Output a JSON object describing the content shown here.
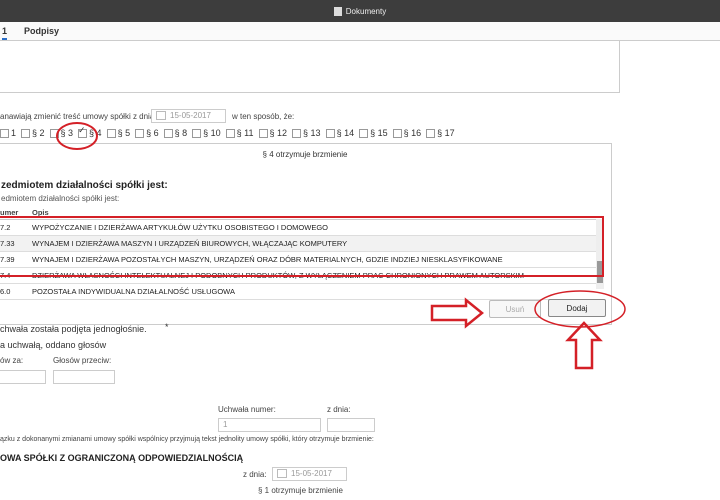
{
  "window": {
    "title": "Dokumenty"
  },
  "tabs": [
    {
      "label": "1"
    },
    {
      "label": "Podpisy"
    }
  ],
  "intro": {
    "prefix": "anawiają zmienić treść umowy spółki z dnia",
    "date": "15-05-2017",
    "suffix": "w ten sposób, że:"
  },
  "paragraphs": [
    {
      "label": "1",
      "checked": false
    },
    {
      "label": "§ 2",
      "checked": false
    },
    {
      "label": "§ 3",
      "checked": false
    },
    {
      "label": "§ 4",
      "checked": true
    },
    {
      "label": "§ 5",
      "checked": false
    },
    {
      "label": "§ 6",
      "checked": false
    },
    {
      "label": "§ 8",
      "checked": false
    },
    {
      "label": "§ 10",
      "checked": false
    },
    {
      "label": "§ 11",
      "checked": false
    },
    {
      "label": "§ 12",
      "checked": false
    },
    {
      "label": "§ 13",
      "checked": false
    },
    {
      "label": "§ 14",
      "checked": false
    },
    {
      "label": "§ 15",
      "checked": false
    },
    {
      "label": "§ 16",
      "checked": false
    },
    {
      "label": "§ 17",
      "checked": false
    }
  ],
  "panel": {
    "title": "§ 4 otrzymuje brzmienie",
    "heading": "zedmiotem działalności spółki jest:",
    "subheading": "edmiotem działalności spółki jest:",
    "columns": [
      "umer",
      "Opis"
    ],
    "rows": [
      {
        "num": "7.2",
        "desc": "WYPOŻYCZANIE I DZIERŻAWA ARTYKUŁÓW UŻYTKU OSOBISTEGO I DOMOWEGO"
      },
      {
        "num": "7.33",
        "desc": "WYNAJEM I DZIERŻAWA MASZYN I URZĄDZEŃ BIUROWYCH, WŁĄCZAJĄC KOMPUTERY"
      },
      {
        "num": "7.39",
        "desc": "WYNAJEM I DZIERŻAWA POZOSTAŁYCH MASZYN, URZĄDZEŃ ORAZ DÓBR MATERIALNYCH, GDZIE INDZIEJ NIESKLASYFIKOWANE"
      },
      {
        "num": "7.4",
        "desc": "DZIERŻAWA WŁASNOŚCI INTELEKTUALNEJ I PODOBNYCH PRODUKTÓW, Z WYŁĄCZENIEM PRAC CHRONIONYCH PRAWEM AUTORSKIM"
      },
      {
        "num": "6.0",
        "desc": "POZOSTAŁA INDYWIDUALNA DZIAŁALNOŚĆ USŁUGOWA"
      }
    ],
    "remove_label": "Usuń",
    "add_label": "Dodaj"
  },
  "vote": {
    "text": "chwała została podjęta jednogłośnie.",
    "asterisk": "*",
    "sub": "a uchwałą, oddano głosów",
    "for_label": "ów za:",
    "against_label": "Głosów przeciw:"
  },
  "resolution": {
    "number_label": "Uchwała numer:",
    "number_value": "1",
    "date_label": "z dnia:"
  },
  "consolidated": {
    "text": "ązku z dokonanymi zmianami umowy spółki wspólnicy przyjmują tekst jednolity umowy spółki, który otrzymuje brzmienie:",
    "heading": "OWA SPÓŁKI Z OGRANICZONĄ ODPOWIEDZIALNOŚCIĄ",
    "date_label": "z dnia:",
    "date": "15-05-2017",
    "paragraph": "§ 1 otrzymuje brzmienie"
  },
  "annotations": {
    "color": "#d42027"
  }
}
